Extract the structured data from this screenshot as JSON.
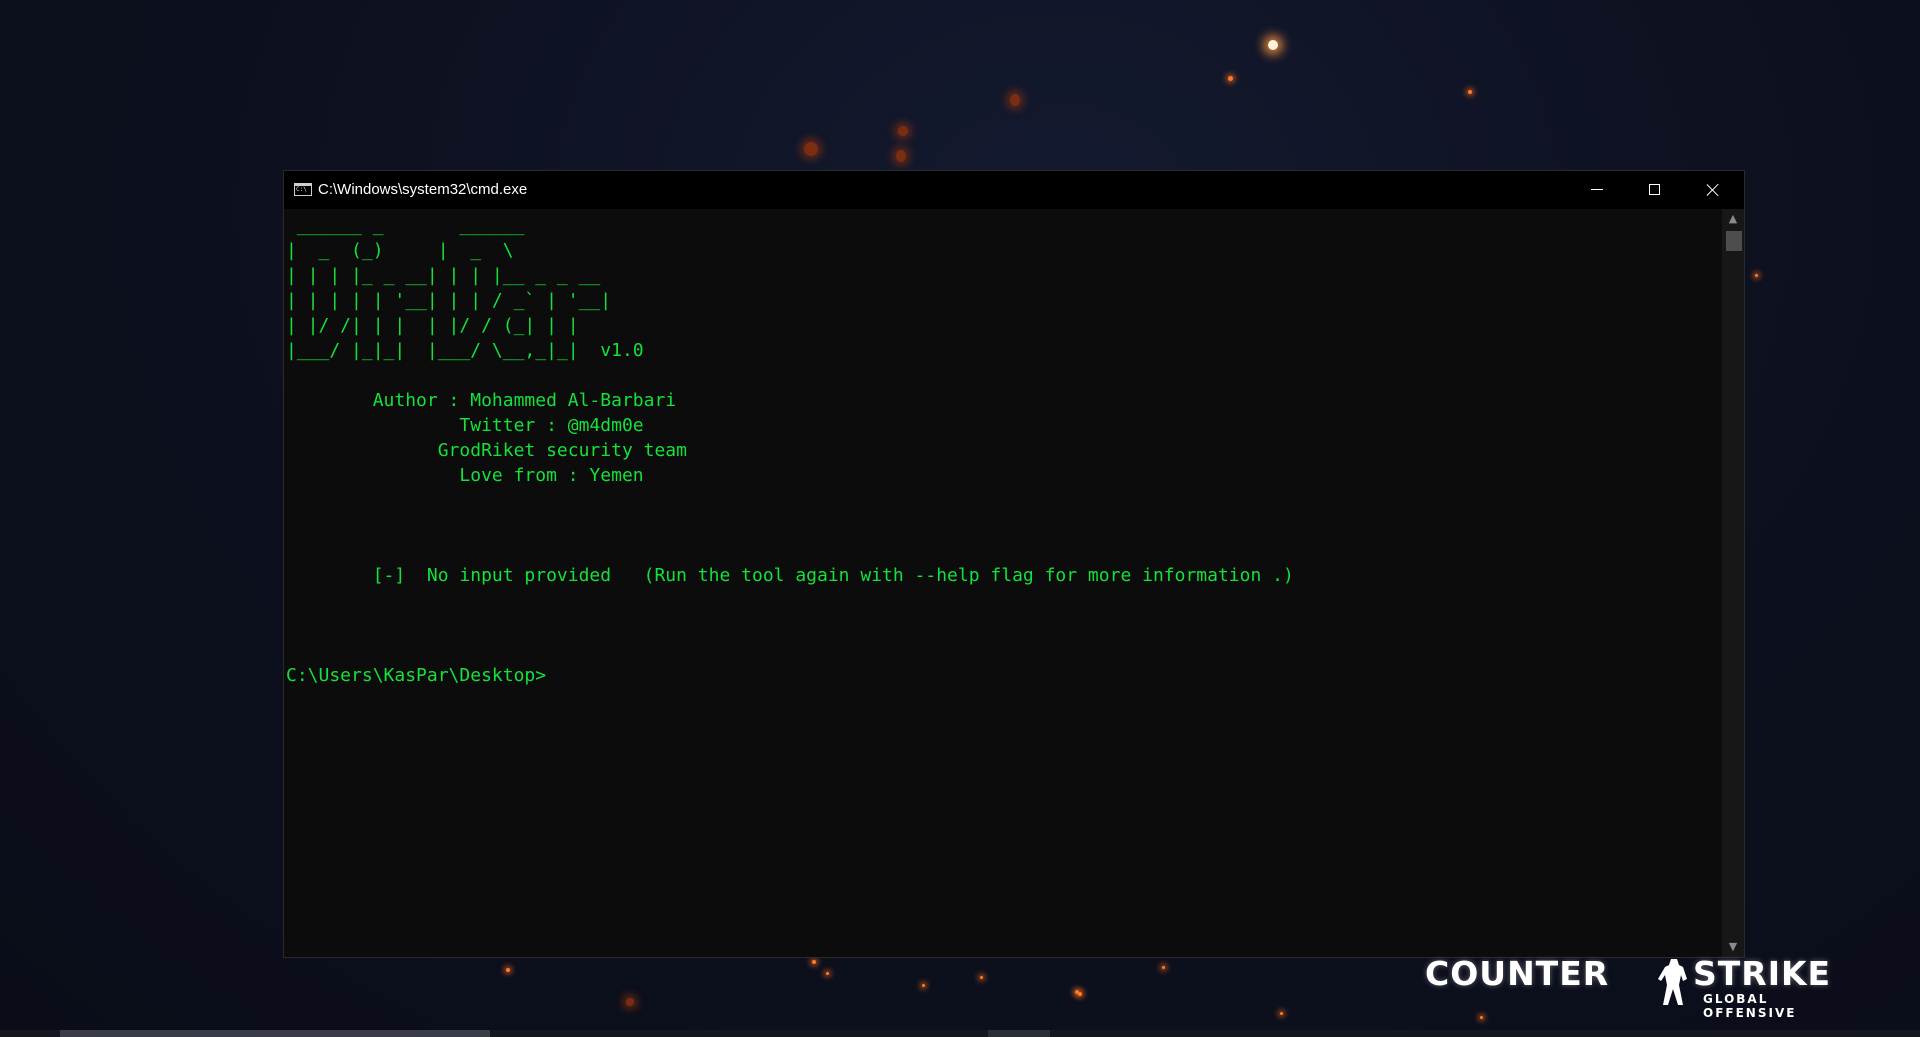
{
  "window": {
    "title": "C:\\Windows\\system32\\cmd.exe",
    "icon": "cmd-icon"
  },
  "window_controls": {
    "minimize_icon": "minimize-icon",
    "maximize_icon": "maximize-icon",
    "close_icon": "close-icon"
  },
  "console": {
    "lines": [
      " ______ _       ______",
      "|  _  (_)     |  _  \\",
      "| | | |_ _ __| | | |__ _ _ __",
      "| | | | | '__| | | / _` | '__|",
      "| |/ /| | |  | |/ / (_| | |",
      "|___/ |_|_|  |___/ \\__,_|_|  v1.0",
      "",
      "        Author : Mohammed Al-Barbari",
      "                Twitter : @m4dm0e",
      "              GrodRiket security team",
      "                Love from : Yemen",
      "",
      "",
      "",
      "        [-]  No input provided   (Run the tool again with --help flag for more information .)",
      "",
      "",
      "",
      "C:\\Users\\KasPar\\Desktop>"
    ],
    "text_color": "#16e03a",
    "background_color": "#0c0c0c"
  },
  "desktop": {
    "logo_word_left": "COUNTER",
    "logo_word_right": "STRIKE",
    "logo_subtitle": "GLOBAL OFFENSIVE",
    "background_color": "#0d1120"
  }
}
